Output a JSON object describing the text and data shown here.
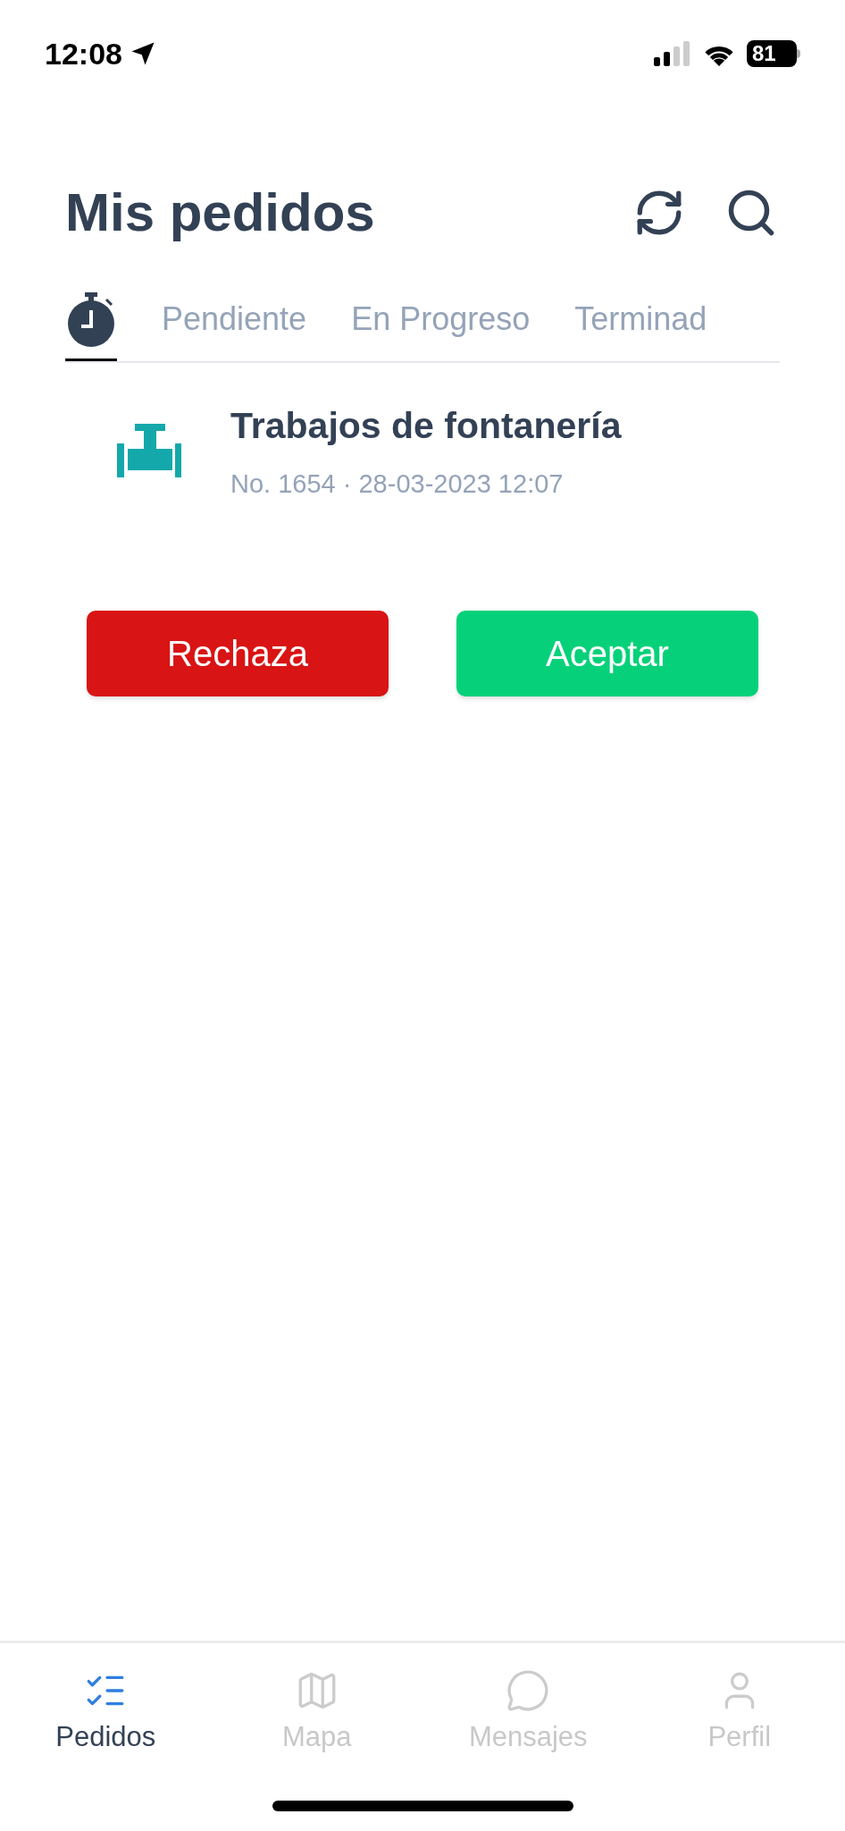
{
  "status_bar": {
    "time": "12:08",
    "battery": "81"
  },
  "header": {
    "title": "Mis pedidos"
  },
  "tabs": [
    {
      "kind": "icon",
      "selected": true
    },
    {
      "kind": "text",
      "label": "Pendiente",
      "selected": false
    },
    {
      "kind": "text",
      "label": "En Progreso",
      "selected": false
    },
    {
      "kind": "text",
      "label": "Terminad",
      "selected": false
    }
  ],
  "orders": [
    {
      "title": "Trabajos de fontanería",
      "meta": "No. 1654 · 28-03-2023 12:07"
    }
  ],
  "actions": [
    {
      "kind": "reject",
      "label": "Rechaza"
    },
    {
      "kind": "accept",
      "label": "Aceptar"
    }
  ],
  "bottom_nav": [
    {
      "kind": "orders",
      "label": "Pedidos",
      "selected": true
    },
    {
      "kind": "map",
      "label": "Mapa",
      "selected": false
    },
    {
      "kind": "messages",
      "label": "Mensajes",
      "selected": false
    },
    {
      "kind": "profile",
      "label": "Perfil",
      "selected": false
    }
  ]
}
